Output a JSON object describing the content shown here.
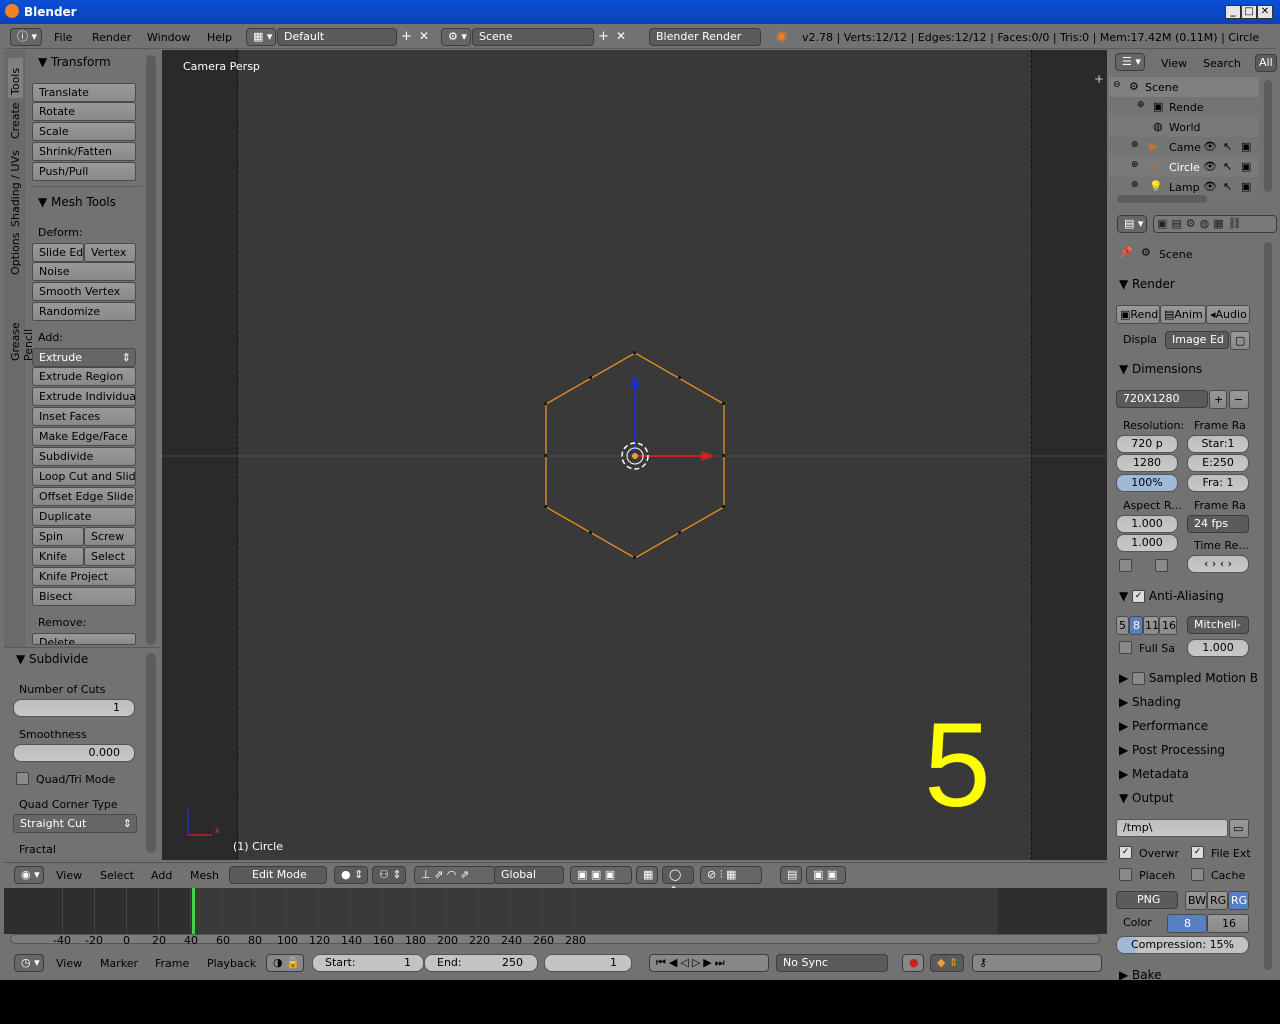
{
  "window": {
    "title": "Blender"
  },
  "infobar": {
    "menus": [
      "File",
      "Render",
      "Window",
      "Help"
    ],
    "layout": "Default",
    "scene": "Scene",
    "engine": "Blender Render",
    "stats": "v2.78 | Verts:12/12 | Edges:12/12 | Faces:0/0 | Tris:0 | Mem:17.42M (0.11M) | Circle"
  },
  "toolshelf": {
    "tabs": [
      "Tools",
      "Create",
      "Shading / UVs",
      "Options",
      "Grease Pencil"
    ],
    "transform": {
      "title": "Transform",
      "buttons": [
        "Translate",
        "Rotate",
        "Scale",
        "Shrink/Fatten",
        "Push/Pull"
      ]
    },
    "mesh_tools": {
      "title": "Mesh Tools",
      "deform_label": "Deform:",
      "slide_edge": "Slide Ed",
      "vertex": "Vertex",
      "deform_buttons": [
        "Noise",
        "Smooth Vertex",
        "Randomize"
      ],
      "add_label": "Add:",
      "extrude": "Extrude",
      "add_buttons": [
        "Extrude Region",
        "Extrude Individual",
        "Inset Faces",
        "Make Edge/Face",
        "Subdivide",
        "Loop Cut and Slide",
        "Offset Edge Slide",
        "Duplicate"
      ],
      "spin": "Spin",
      "screw": "Screw",
      "knife": "Knife",
      "select": "Select",
      "more_buttons": [
        "Knife Project",
        "Bisect"
      ],
      "remove_label": "Remove:",
      "delete": "Delete"
    },
    "operator": {
      "title": "Subdivide",
      "cuts_label": "Number of Cuts",
      "cuts_value": "1",
      "smooth_label": "Smoothness",
      "smooth_value": "0.000",
      "quadtri": "Quad/Tri Mode",
      "corner_label": "Quad Corner Type",
      "corner_value": "Straight Cut",
      "fractal": "Fractal"
    }
  },
  "viewport": {
    "view_name": "Camera Persp",
    "object_label": "(1) Circle",
    "overlay_number": "5",
    "colors": {
      "edge": "#e8901e",
      "bg": "#393939",
      "axis_x": "#d02020",
      "axis_z": "#1a30c8",
      "overlay": "#ffff00"
    }
  },
  "view3d_header": {
    "menus": [
      "View",
      "Select",
      "Add",
      "Mesh"
    ],
    "mode": "Edit Mode",
    "orientation": "Global"
  },
  "timeline": {
    "ticks": [
      "-40",
      "-20",
      "0",
      "20",
      "40",
      "60",
      "80",
      "100",
      "120",
      "140",
      "160",
      "180",
      "200",
      "220",
      "240",
      "260",
      "280"
    ],
    "menus": [
      "View",
      "Marker",
      "Frame",
      "Playback"
    ],
    "start_label": "Start:",
    "start_value": "1",
    "end_label": "End:",
    "end_value": "250",
    "current": "1",
    "sync": "No Sync"
  },
  "outliner": {
    "menus": [
      "View",
      "Search"
    ],
    "filter": "All",
    "items": [
      "Scene",
      "Rende",
      "World",
      "Came",
      "Circle",
      "Lamp"
    ]
  },
  "properties": {
    "context": "Scene",
    "render": {
      "title": "Render",
      "rend": "Rend",
      "anim": "Anim",
      "audio": "Audio",
      "display_label": "Displa",
      "display_value": "Image Ed"
    },
    "dimensions": {
      "title": "Dimensions",
      "preset": "720X1280",
      "res_label": "Resolution:",
      "res_x": "720 p",
      "res_y": "1280",
      "res_pct": "100%",
      "frame_range_label": "Frame Ra",
      "start": "Star:1",
      "end": "E:250",
      "step": "Fra: 1",
      "aspect_label": "Aspect R...",
      "aspect_x": "1.000",
      "aspect_y": "1.000",
      "frame_rate_label": "Frame Ra",
      "fps": "24 fps",
      "time_remap": "Time Re..."
    },
    "antialiasing": {
      "title": "Anti-Aliasing",
      "samples": [
        "5",
        "8",
        "11",
        "16"
      ],
      "filter": "Mitchell-",
      "full_sample": "Full Sa",
      "size": "1.000"
    },
    "collapsed": [
      "Sampled Motion Bl",
      "Shading",
      "Performance",
      "Post Processing",
      "Metadata"
    ],
    "output": {
      "title": "Output",
      "path": "/tmp\\",
      "overwrite": "Overwr",
      "file_ext": "File Ext",
      "placeholders": "Placeh",
      "cache": "Cache",
      "format": "PNG",
      "bw": "BW",
      "rgb": "RG",
      "rgba": "RG",
      "color_label": "Color",
      "depth8": "8",
      "depth16": "16",
      "compression": "Compression:",
      "compression_value": "15%"
    },
    "bake": "Bake"
  }
}
